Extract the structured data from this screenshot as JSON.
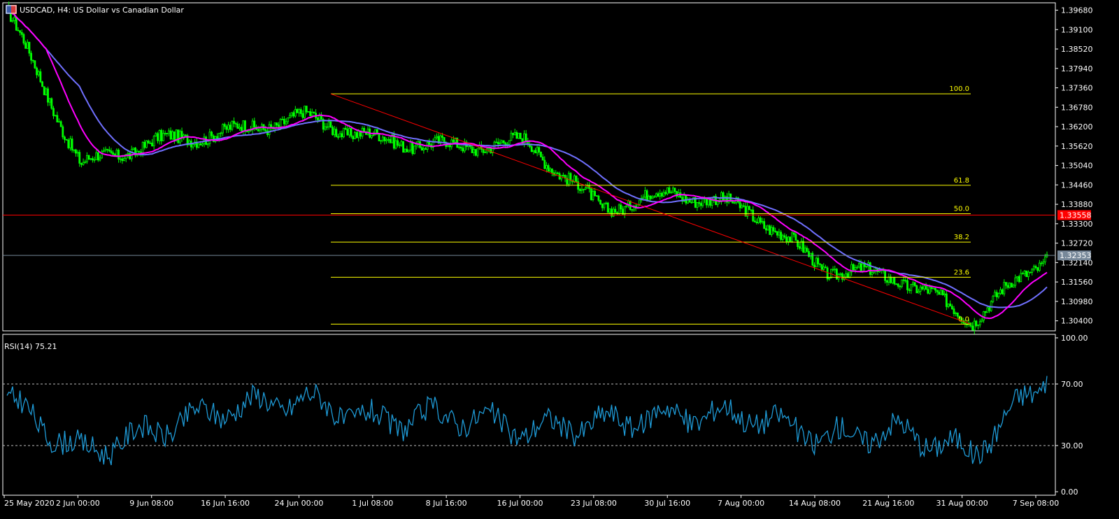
{
  "window": {
    "title": "USDCAD, H4:  US Dollar vs Canadian Dollar",
    "flag_icon": "usd-cad-flag-icon"
  },
  "price_chart": {
    "y_ticks": [
      "1.39680",
      "1.39100",
      "1.38520",
      "1.37940",
      "1.37360",
      "1.36780",
      "1.36200",
      "1.35620",
      "1.35040",
      "1.34460",
      "1.33880",
      "1.33300",
      "1.32720",
      "1.32140",
      "1.31560",
      "1.30980",
      "1.30400"
    ],
    "bid_label": "1.33558",
    "current_label": "1.32353",
    "fib_levels": [
      {
        "label": "100.0",
        "price": 1.3718
      },
      {
        "label": "61.8",
        "price": 1.3445
      },
      {
        "label": "50.0",
        "price": 1.336
      },
      {
        "label": "38.2",
        "price": 1.3275
      },
      {
        "label": "23.6",
        "price": 1.317
      },
      {
        "label": "0.0",
        "price": 1.303
      }
    ],
    "colors": {
      "background": "#000000",
      "candle": "#00ff00",
      "ma_fast": "#ff00ff",
      "ma_slow": "#7070ff",
      "fib": "#ffff00",
      "trend": "#ff0000",
      "bid_line": "#ff0000",
      "ask_line": "#778899"
    }
  },
  "rsi": {
    "title": "RSI(14) 75.21",
    "y_ticks": [
      "100.00",
      "70.00",
      "30.00",
      "0.00"
    ],
    "levels": [
      70,
      30
    ],
    "color": "#1e9ad6"
  },
  "x_axis": {
    "labels": [
      "25 May 2020",
      "2 Jun 00:00",
      "9 Jun 08:00",
      "16 Jun 16:00",
      "24 Jun 00:00",
      "1 Jul 08:00",
      "8 Jul 16:00",
      "16 Jul 00:00",
      "23 Jul 08:00",
      "30 Jul 16:00",
      "7 Aug 00:00",
      "14 Aug 08:00",
      "21 Aug 16:00",
      "31 Aug 00:00",
      "7 Sep 08:00"
    ]
  },
  "chart_data": {
    "type": "line",
    "symbol": "USDCAD",
    "timeframe": "H4",
    "x": [
      "25 May 2020",
      "2 Jun 00:00",
      "9 Jun 08:00",
      "16 Jun 16:00",
      "24 Jun 00:00",
      "1 Jul 08:00",
      "8 Jul 16:00",
      "16 Jul 00:00",
      "23 Jul 08:00",
      "30 Jul 16:00",
      "7 Aug 00:00",
      "14 Aug 08:00",
      "21 Aug 16:00",
      "31 Aug 00:00",
      "7 Sep 08:00"
    ],
    "series": [
      {
        "values": [
          1.3968,
          1.3505,
          1.3575,
          1.3605,
          1.365,
          1.358,
          1.356,
          1.3575,
          1.3375,
          1.3425,
          1.337,
          1.3195,
          1.317,
          1.3045,
          1.3235
        ]
      },
      {
        "values": [
          60,
          25,
          40,
          55,
          60,
          45,
          50,
          40,
          45,
          50,
          50,
          35,
          40,
          25,
          75.21
        ]
      }
    ],
    "ylim": [
      1.301,
      1.399
    ],
    "rsi_ylim": [
      0,
      100
    ]
  }
}
